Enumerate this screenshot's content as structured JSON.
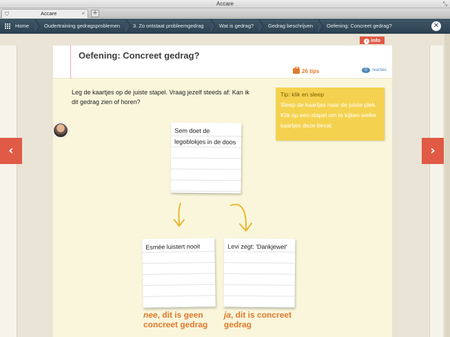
{
  "window": {
    "title": "Accare",
    "resize_glyph": "⤡"
  },
  "tabs": [
    {
      "label": "Accare",
      "close": "×",
      "icon": "app-icon"
    }
  ],
  "newtab_label": "+",
  "breadcrumb": {
    "items": [
      "Home",
      "Oudertraining gedragsproblemen",
      "3. Zo ontstaat probleemgedrag",
      "Wat is gedrag?",
      "Gedrag beschrijven",
      "Oefening: Concreet gedrag?"
    ]
  },
  "close_label": "✕",
  "info_label": "info",
  "info_icon": "i",
  "card": {
    "title": "Oefening: Concreet gedrag?",
    "tips_label": "26 tips",
    "reacties_count": "0",
    "reacties_label": "reacties"
  },
  "instruction": "Leg de kaartjes op de juiste stapel. Vraag jezelf steeds af: Kan ik dit gedrag zien of horen?",
  "tip": {
    "title": "Tip: klik en sleep",
    "body": "Sleep de kaartjes naar de juiste plek. Klik op een stapel om te kijken welke kaartjes deze bevat."
  },
  "cards": {
    "top": "Sem doet de legoblokjes in de doos",
    "left": "Esmée luistert nooit",
    "right": "Levi zegt: 'Dankjewel'"
  },
  "piles": {
    "left": {
      "prefix": "nee",
      "rest": ", dit is geen concreet gedrag"
    },
    "right": {
      "prefix": "ja",
      "rest": ", dit is concreet gedrag"
    }
  },
  "nav": {
    "prev": "‹",
    "next": "›"
  },
  "colors": {
    "accent": "#e05a45",
    "orange": "#e0782a",
    "navbar": "#2b4050",
    "tip": "#f4d24f"
  }
}
